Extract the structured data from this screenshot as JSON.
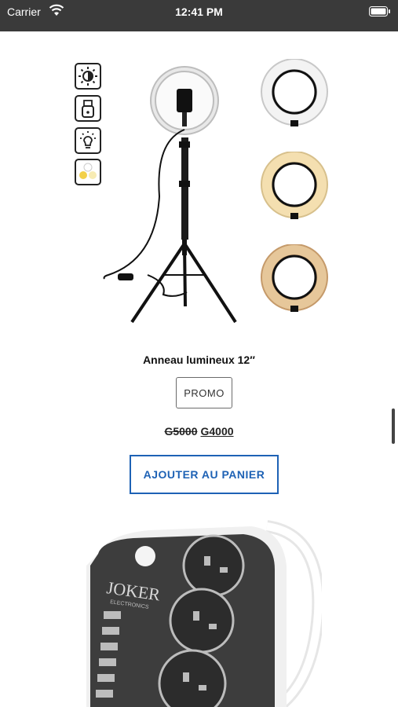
{
  "status_bar": {
    "carrier": "Carrier",
    "time": "12:41 PM"
  },
  "product_1": {
    "name": "Anneau lumineux 12″",
    "badge": "PROMO",
    "price_old": "G5000",
    "price_new": "G4000",
    "add_to_cart_label": "AJOUTER AU PANIER",
    "feature_icons": [
      "brightness-icon",
      "usb-icon",
      "light-bulb-icon",
      "color-modes-icon"
    ],
    "ring_variants": [
      {
        "name": "cool-white-ring",
        "color": "#f2f2f2"
      },
      {
        "name": "warm-white-ring",
        "color": "#f4dfb0"
      },
      {
        "name": "warm-light-ring",
        "color": "#e6c79a"
      }
    ]
  },
  "product_2": {
    "brand_logo": "JOKER",
    "brand_sub": "ELECTRONICS"
  },
  "colors": {
    "accent": "#1e62b5",
    "status_bar": "#3a3a3a"
  }
}
